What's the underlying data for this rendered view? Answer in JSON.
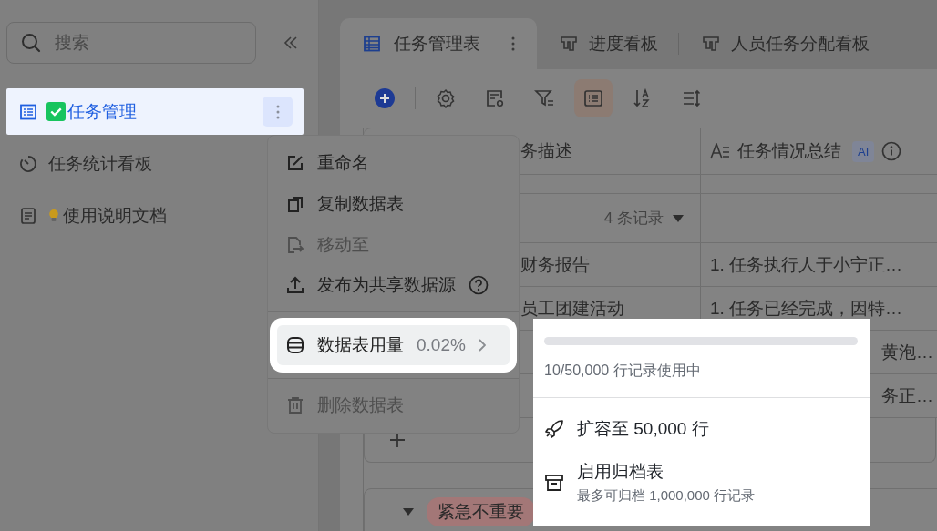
{
  "sidebar": {
    "search": {
      "placeholder": "搜索"
    },
    "items": [
      {
        "label": "任务管理",
        "kind": "table",
        "prefix": {
          "kind": "check"
        },
        "selected": true
      },
      {
        "label": "任务统计看板",
        "kind": "dashboard",
        "selected": false
      },
      {
        "label": "使用说明文档",
        "kind": "doc",
        "prefix": {
          "kind": "bulb"
        },
        "selected": false
      }
    ]
  },
  "tabs": [
    {
      "label": "任务管理表",
      "kind": "table",
      "selected": true
    },
    {
      "label": "进度看板",
      "kind": "kanban",
      "selected": false
    },
    {
      "label": "人员任务分配看板",
      "kind": "kanban",
      "selected": false
    }
  ],
  "toolbar": [
    {
      "kind": "add",
      "selected": false
    },
    {
      "kind": "settings",
      "selected": false
    },
    {
      "kind": "form",
      "selected": false
    },
    {
      "kind": "filter",
      "selected": false
    },
    {
      "kind": "list",
      "selected": true
    },
    {
      "kind": "sort",
      "selected": false
    },
    {
      "kind": "height",
      "selected": false
    }
  ],
  "table": {
    "columns": [
      {
        "label": "务描述"
      },
      {
        "label": "任务情况总结",
        "badge": "AI"
      }
    ],
    "group": {
      "count": "4 条记录"
    },
    "rows": [
      [
        "财务报告",
        "1. 任务执行人于小宁正…"
      ],
      [
        "员工团建活动",
        "1. 任务已经完成，因特…"
      ],
      [
        "",
        "黄泡…"
      ],
      [
        "",
        "务正…"
      ]
    ],
    "group_2": {
      "tag": "紧急不重要"
    }
  },
  "context_menu": {
    "items": [
      {
        "label": "重命名",
        "kind": "edit",
        "disabled": false,
        "selected": false
      },
      {
        "label": "复制数据表",
        "kind": "copy",
        "disabled": false,
        "selected": false
      },
      {
        "label": "移动至",
        "kind": "move",
        "disabled": true,
        "selected": false
      },
      {
        "label": "发布为共享数据源",
        "kind": "publish",
        "disabled": false,
        "selected": false,
        "help": true
      },
      {
        "label": "数据表用量",
        "kind": "usage",
        "disabled": false,
        "selected": true,
        "value": "0.02%"
      },
      {
        "label": "删除数据表",
        "kind": "delete",
        "disabled": true,
        "selected": false
      }
    ]
  },
  "usage_panel": {
    "level": 0.0002,
    "reading": "10/50,000 行记录使用中",
    "actions": [
      {
        "label": "扩容至 50,000 行",
        "kind": "rocket"
      },
      {
        "label": "启用归档表",
        "kind": "archive",
        "description": "最多可归档 1,000,000 行记录"
      }
    ]
  }
}
